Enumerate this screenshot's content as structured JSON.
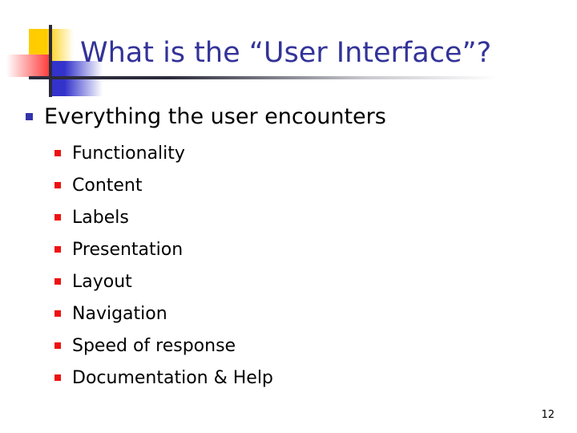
{
  "slide": {
    "title": "What is the “User Interface”?",
    "page_number": "12",
    "colors": {
      "title": "#333399",
      "level1_bullet": "#3333aa",
      "level2_bullet": "#ee1111",
      "deco_yellow": "#ffcc00",
      "deco_red": "#ff4040",
      "deco_blue": "#3333cc",
      "rule": "#2b2b3c",
      "body_text": "#000000"
    },
    "content": {
      "level1": [
        {
          "text": "Everything the user encounters",
          "children": [
            "Functionality",
            "Content",
            "Labels",
            "Presentation",
            "Layout",
            "Navigation",
            "Speed of response",
            "Documentation & Help"
          ]
        }
      ]
    },
    "decoration": {
      "yellow_square": "yellow-square",
      "red_square": "red-square",
      "blue_square": "blue-square",
      "vertical_rule": "vertical-rule",
      "horizontal_rule": "horizontal-rule"
    }
  }
}
